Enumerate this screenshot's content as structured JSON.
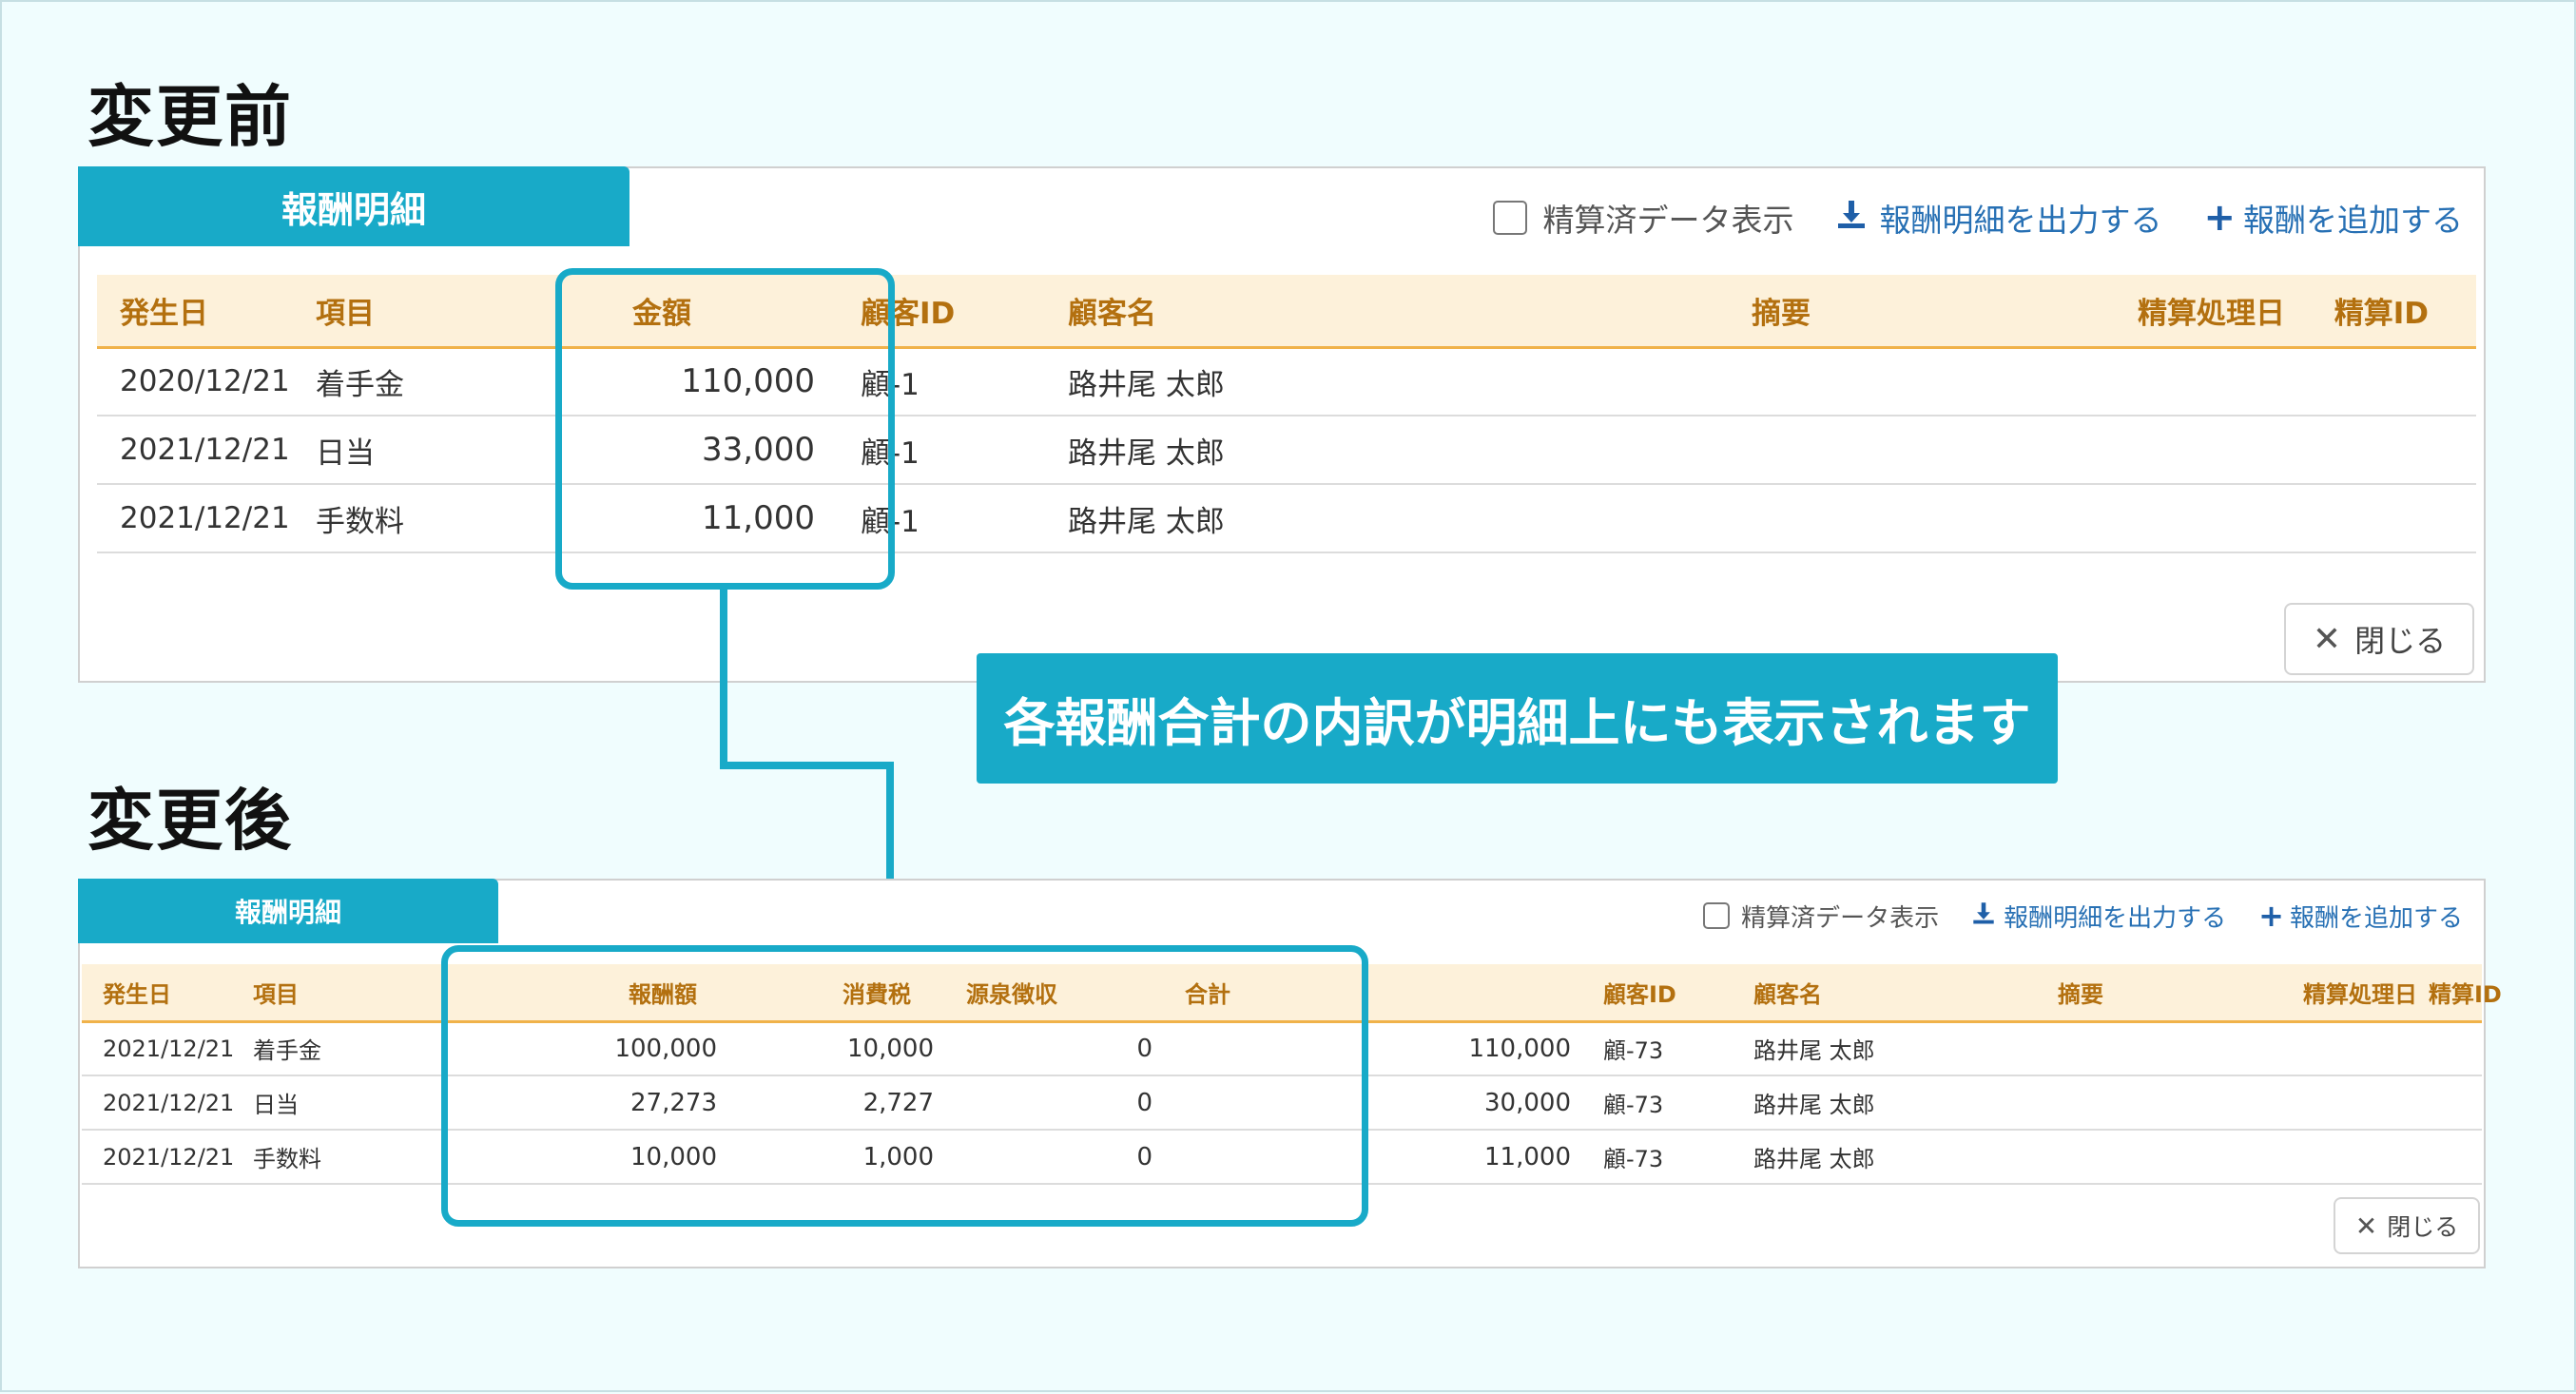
{
  "before": {
    "label": "変更前",
    "tab_title": "報酬明細",
    "toolbar": {
      "checkbox_label": "精算済データ表示",
      "export_label": "報酬明細を出力する",
      "add_label": "報酬を追加する"
    },
    "columns": [
      "発生日",
      "項目",
      "金額",
      "顧客ID",
      "顧客名",
      "摘要",
      "精算処理日",
      "精算ID"
    ],
    "rows": [
      [
        "2020/12/21",
        "着手金",
        "110,000",
        "顧-1",
        "路井尾 太郎"
      ],
      [
        "2021/12/21",
        "日当",
        "33,000",
        "顧-1",
        "路井尾 太郎"
      ],
      [
        "2021/12/21",
        "手数料",
        "11,000",
        "顧-1",
        "路井尾 太郎"
      ]
    ],
    "close_label": "閉じる"
  },
  "callout": "各報酬合計の内訳が明細上にも表示されます",
  "after": {
    "label": "変更後",
    "tab_title": "報酬明細",
    "toolbar": {
      "checkbox_label": "精算済データ表示",
      "export_label": "報酬明細を出力する",
      "add_label": "報酬を追加する"
    },
    "columns": [
      "発生日",
      "項目",
      "報酬額",
      "消費税",
      "源泉徴収",
      "合計",
      "顧客ID",
      "顧客名",
      "摘要",
      "精算処理日",
      "精算ID"
    ],
    "rows": [
      [
        "2021/12/21",
        "着手金",
        "100,000",
        "10,000",
        "0",
        "110,000",
        "顧-73",
        "路井尾 太郎"
      ],
      [
        "2021/12/21",
        "日当",
        "27,273",
        "2,727",
        "0",
        "30,000",
        "顧-73",
        "路井尾 太郎"
      ],
      [
        "2021/12/21",
        "手数料",
        "10,000",
        "1,000",
        "0",
        "11,000",
        "顧-73",
        "路井尾 太郎"
      ]
    ],
    "close_label": "閉じる"
  },
  "icons": {
    "download": "download-icon",
    "plus": "plus-icon",
    "close": "close-icon"
  },
  "colors": {
    "accent": "#18aac8",
    "header_bg": "#fdf1da",
    "header_text": "#b3700f",
    "link": "#2770b4"
  }
}
